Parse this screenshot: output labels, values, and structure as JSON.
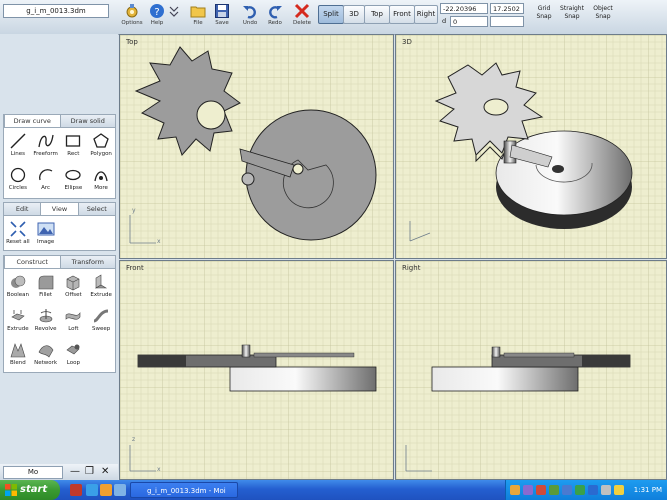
{
  "app": {
    "file_name": "g_i_m_0013.3dm"
  },
  "toolbar": {
    "buttons": [
      {
        "key": "options",
        "label": "Options",
        "icon": "options-icon"
      },
      {
        "key": "help",
        "label": "Help",
        "icon": "help-icon"
      },
      {
        "key": "file",
        "label": "File",
        "icon": "folder-icon"
      },
      {
        "key": "save",
        "label": "Save",
        "icon": "save-icon"
      },
      {
        "key": "undo",
        "label": "Undo",
        "icon": "undo-icon"
      },
      {
        "key": "redo",
        "label": "Redo",
        "icon": "redo-icon"
      },
      {
        "key": "delete",
        "label": "Delete",
        "icon": "delete-icon"
      }
    ],
    "view_buttons": [
      "Split",
      "3D",
      "Top",
      "Front",
      "Right"
    ],
    "active_view": "Split",
    "coord_x": "-22.20396",
    "coord_y": "0",
    "coord_z": "17.2502",
    "coord_d_prefix": "d",
    "snap_items": [
      {
        "top": "Grid",
        "bottom": "Snap"
      },
      {
        "top": "Straight",
        "bottom": "Snap"
      },
      {
        "top": "Object",
        "bottom": "Snap"
      }
    ]
  },
  "palettes": {
    "draw": {
      "tabs": [
        "Draw curve",
        "Draw solid"
      ],
      "active": 0,
      "tools": [
        {
          "label": "Lines",
          "icon": "line-tool-icon"
        },
        {
          "label": "Freeform",
          "icon": "freeform-tool-icon"
        },
        {
          "label": "Rect",
          "icon": "rectangle-tool-icon"
        },
        {
          "label": "Polygon",
          "icon": "polygon-tool-icon"
        },
        {
          "label": "Circles",
          "icon": "circle-tool-icon"
        },
        {
          "label": "Arc",
          "icon": "arc-tool-icon"
        },
        {
          "label": "Ellipse",
          "icon": "ellipse-tool-icon"
        },
        {
          "label": "More",
          "icon": "more-tool-icon"
        }
      ]
    },
    "view": {
      "tabs": [
        "Edit",
        "View",
        "Select"
      ],
      "active": 1,
      "tools": [
        {
          "label": "Reset all",
          "icon": "reset-all-icon"
        },
        {
          "label": "Image",
          "icon": "image-icon"
        }
      ]
    },
    "solid": {
      "tabs": [
        "Construct",
        "Transform"
      ],
      "active": 0,
      "tools": [
        {
          "label": "Boolean",
          "icon": "boolean-icon"
        },
        {
          "label": "Fillet",
          "icon": "fillet-icon"
        },
        {
          "label": "Offset",
          "icon": "offset-icon"
        },
        {
          "label": "Extrude",
          "icon": "extrude-face-icon"
        },
        {
          "label": "Extrude",
          "icon": "extrude-icon"
        },
        {
          "label": "Revolve",
          "icon": "revolve-icon"
        },
        {
          "label": "Loft",
          "icon": "loft-icon"
        },
        {
          "label": "Sweep",
          "icon": "sweep-icon"
        },
        {
          "label": "Blend",
          "icon": "blend-icon"
        },
        {
          "label": "Network",
          "icon": "network-icon"
        },
        {
          "label": "Loop",
          "icon": "loop-icon"
        }
      ]
    }
  },
  "mini_panel": {
    "label": "Mo"
  },
  "viewports": [
    {
      "key": "top",
      "label": "Top"
    },
    {
      "key": "3d",
      "label": "3D"
    },
    {
      "key": "front",
      "label": "Front"
    },
    {
      "key": "right",
      "label": "Right"
    }
  ],
  "axis": {
    "x": "x",
    "y": "y",
    "z": "z"
  },
  "colors": {
    "grid_bg": "#eeeecf",
    "grid_minor": "#d8d8b2",
    "grid_major": "#c2c29a",
    "model_fill": "#9c9c9c",
    "accent": "#2f5fb0"
  },
  "taskbar": {
    "start_label": "start",
    "task_label": "g_i_m_0013.3dm - Moi",
    "clock": "1:31 PM"
  }
}
